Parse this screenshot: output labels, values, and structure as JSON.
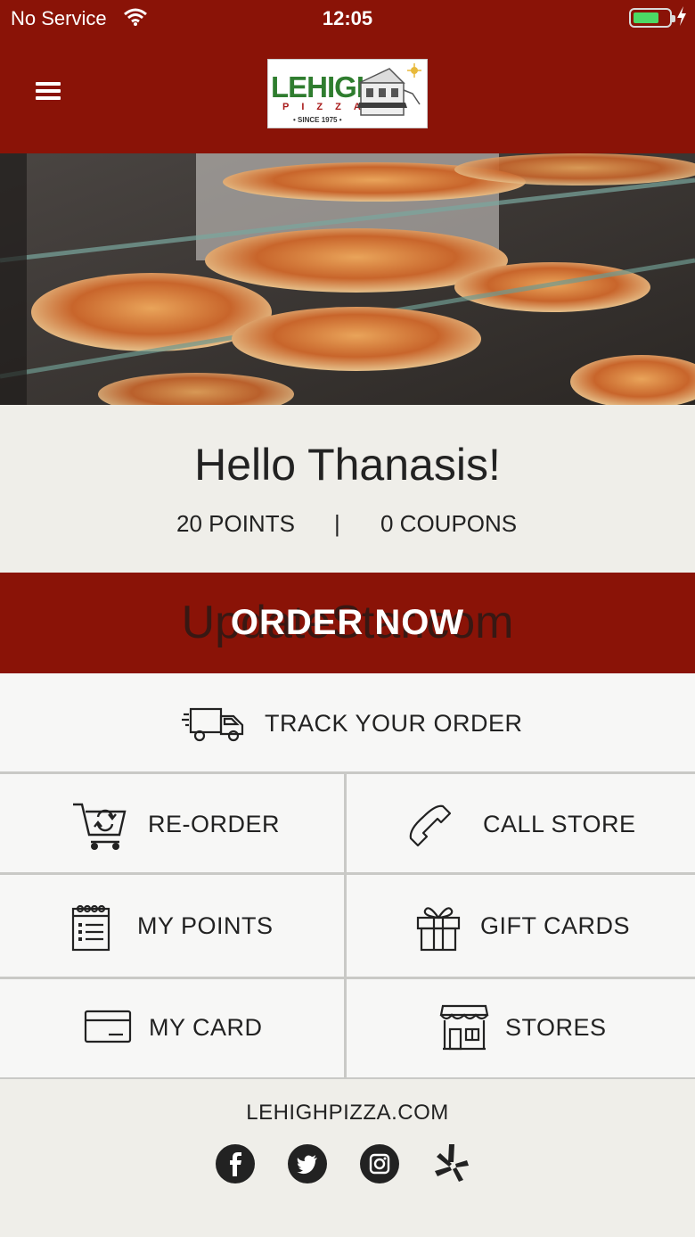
{
  "status": {
    "carrier": "No Service",
    "time": "12:05"
  },
  "header": {
    "logo": {
      "word": "LEHIGH",
      "sub": "PIZZA",
      "since": "• SINCE 1975 •"
    }
  },
  "greeting": {
    "hello": "Hello Thanasis!",
    "points": "20 POINTS",
    "separator": "|",
    "coupons": "0 COUPONS"
  },
  "order": {
    "label": "ORDER NOW",
    "watermark": "UpdateStar.com"
  },
  "tiles": {
    "track": "TRACK YOUR ORDER",
    "reorder": "RE-ORDER",
    "call": "CALL STORE",
    "points": "MY POINTS",
    "gift": "GIFT CARDS",
    "card": "MY CARD",
    "stores": "STORES"
  },
  "footer": {
    "site": "LEHIGHPIZZA.COM"
  },
  "icons": {
    "menu": "hamburger-icon",
    "track": "delivery-truck-icon",
    "reorder": "cart-reload-icon",
    "call": "phone-icon",
    "points": "notepad-icon",
    "gift": "gift-icon",
    "card": "credit-card-icon",
    "stores": "storefront-icon",
    "social": [
      "facebook-icon",
      "twitter-icon",
      "instagram-icon",
      "yelp-icon"
    ]
  },
  "colors": {
    "brand": "#8a1307",
    "background": "#efeee9",
    "tile": "#f7f7f6"
  }
}
